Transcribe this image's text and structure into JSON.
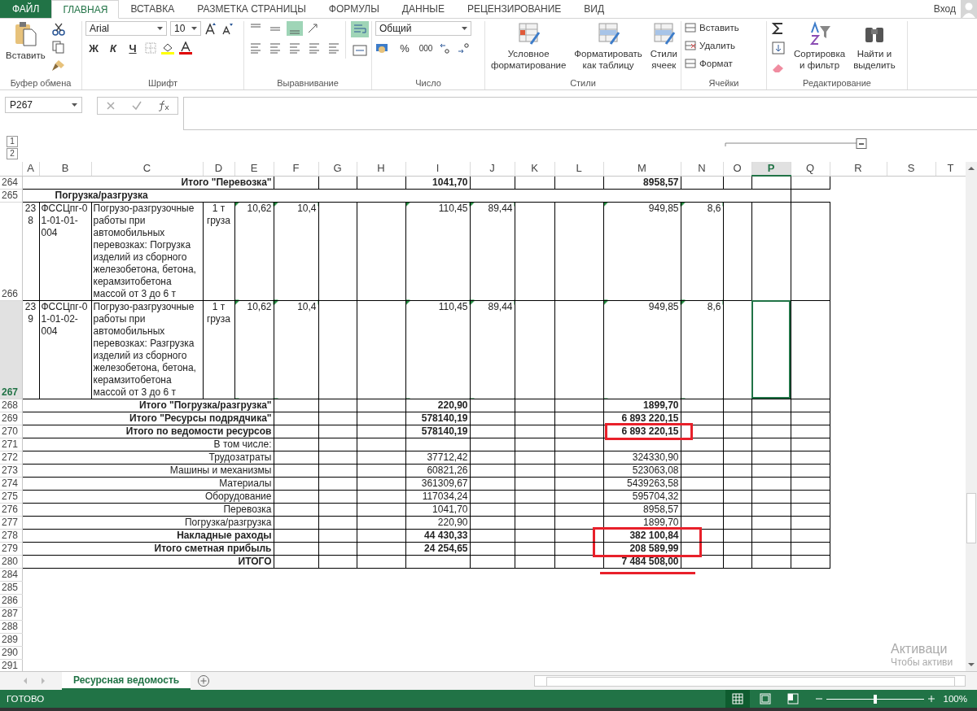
{
  "ribbon_tabs": [
    {
      "label": "ФАЙЛ",
      "kind": "file",
      "selected": false
    },
    {
      "label": "ГЛАВНАЯ",
      "kind": "tab",
      "selected": true
    },
    {
      "label": "ВСТАВКА",
      "kind": "tab",
      "selected": false
    },
    {
      "label": "РАЗМЕТКА СТРАНИЦЫ",
      "kind": "tab",
      "selected": false
    },
    {
      "label": "ФОРМУЛЫ",
      "kind": "tab",
      "selected": false
    },
    {
      "label": "ДАННЫЕ",
      "kind": "tab",
      "selected": false
    },
    {
      "label": "РЕЦЕНЗИРОВАНИЕ",
      "kind": "tab",
      "selected": false
    },
    {
      "label": "ВИД",
      "kind": "tab",
      "selected": false
    }
  ],
  "sign_in": "Вход",
  "ribbon": {
    "clipboard": {
      "paste": "Вставить",
      "label": "Буфер обмена"
    },
    "font": {
      "family": "Arial",
      "size": "10",
      "bold": "Ж",
      "italic": "К",
      "underline": "Ч",
      "label": "Шрифт"
    },
    "alignment": {
      "vertical": [
        {
          "selected": false
        },
        {
          "selected": false
        },
        {
          "selected": true
        }
      ],
      "wrap_text": {
        "on": true
      },
      "label": "Выравнивание"
    },
    "number": {
      "format": "Общий",
      "percent": "%",
      "thousands": "000",
      "label": "Число"
    },
    "styles": {
      "buttons": [
        {
          "lines": [
            "Условное",
            "форматирование"
          ]
        },
        {
          "lines": [
            "Форматировать",
            "как таблицу"
          ]
        },
        {
          "lines": [
            "Стили",
            "ячеек"
          ]
        }
      ],
      "label": "Стили"
    },
    "cells": {
      "buttons": [
        "Вставить",
        "Удалить",
        "Формат"
      ],
      "label": "Ячейки"
    },
    "editing": {
      "buttons": [
        {
          "lines": [
            "Сортировка",
            "и фильтр"
          ]
        },
        {
          "lines": [
            "Найти и",
            "выделить"
          ]
        }
      ],
      "label": "Редактирование"
    }
  },
  "formula_bar": {
    "name_box": "P267"
  },
  "outline_levels": [
    "1",
    "2"
  ],
  "grid": {
    "columns": [
      {
        "label": "A",
        "selected": false
      },
      {
        "label": "B",
        "selected": false
      },
      {
        "label": "C",
        "selected": false
      },
      {
        "label": "D",
        "selected": false
      },
      {
        "label": "E",
        "selected": false
      },
      {
        "label": "F",
        "selected": false
      },
      {
        "label": "G",
        "selected": false
      },
      {
        "label": "H",
        "selected": false
      },
      {
        "label": "I",
        "selected": false
      },
      {
        "label": "J",
        "selected": false
      },
      {
        "label": "K",
        "selected": false
      },
      {
        "label": "L",
        "selected": false
      },
      {
        "label": "M",
        "selected": false
      },
      {
        "label": "N",
        "selected": false
      },
      {
        "label": "O",
        "selected": false
      },
      {
        "label": "P",
        "selected": true
      },
      {
        "label": "Q",
        "selected": false
      },
      {
        "label": "R",
        "selected": false
      },
      {
        "label": "S",
        "selected": false
      },
      {
        "label": "T",
        "selected": false
      }
    ],
    "rows": [
      {
        "number": "264",
        "kind": "total",
        "selected": false,
        "label": "Итого \"Перевозка\"",
        "value_i": "1041,70",
        "value_m": "8958,57"
      },
      {
        "number": "265",
        "kind": "section",
        "selected": false,
        "label": "Погрузка/разгрузка"
      },
      {
        "number": "266",
        "kind": "item",
        "selected": false,
        "num": "238",
        "code": "ФССЦпг-01-01-01-004",
        "description": "Погрузо-разгрузочные работы при автомобильных перевозках: Погрузка изделий из сборного железобетона, бетона, керамзитобетона массой от 3 до 6 т",
        "unit": "1 т груза",
        "value_e": "10,62",
        "value_f": "10,4",
        "value_i": "110,45",
        "value_j": "89,44",
        "value_m": "949,85",
        "value_n": "8,6"
      },
      {
        "number": "267",
        "kind": "item",
        "selected": true,
        "num": "239",
        "code": "ФССЦпг-01-01-02-004",
        "description": "Погрузо-разгрузочные работы при автомобильных перевозках: Разгрузка изделий из сборного железобетона, бетона, керамзитобетона массой от 3 до 6 т",
        "unit": "1 т груза",
        "value_e": "10,62",
        "value_f": "10,4",
        "value_i": "110,45",
        "value_j": "89,44",
        "value_m": "949,85",
        "value_n": "8,6"
      },
      {
        "number": "268",
        "kind": "total",
        "selected": false,
        "label": "Итого \"Погрузка/разгрузка\"",
        "value_i": "220,90",
        "value_m": "1899,70"
      },
      {
        "number": "269",
        "kind": "total",
        "selected": false,
        "label": "Итого \"Ресурсы подрядчика\"",
        "value_i": "578140,19",
        "value_m": "6 893 220,15"
      },
      {
        "number": "270",
        "kind": "total",
        "selected": false,
        "label": "Итого по ведомости ресурсов",
        "value_i": "578140,19",
        "value_m": "6 893 220,15",
        "highlighted": true
      },
      {
        "number": "271",
        "kind": "detail",
        "selected": false,
        "label": "В том числе:"
      },
      {
        "number": "272",
        "kind": "detail",
        "selected": false,
        "label": "Трудозатраты",
        "value_i": "37712,42",
        "value_m": "324330,90"
      },
      {
        "number": "273",
        "kind": "detail",
        "selected": false,
        "label": "Машины и механизмы",
        "value_i": "60821,26",
        "value_m": "523063,08"
      },
      {
        "number": "274",
        "kind": "detail",
        "selected": false,
        "label": "Материалы",
        "value_i": "361309,67",
        "value_m": "5439263,58"
      },
      {
        "number": "275",
        "kind": "detail",
        "selected": false,
        "label": "Оборудование",
        "value_i": "117034,24",
        "value_m": "595704,32"
      },
      {
        "number": "276",
        "kind": "detail",
        "selected": false,
        "label": "Перевозка",
        "value_i": "1041,70",
        "value_m": "8958,57"
      },
      {
        "number": "277",
        "kind": "detail",
        "selected": false,
        "label": "Погрузка/разгрузка",
        "value_i": "220,90",
        "value_m": "1899,70"
      },
      {
        "number": "278",
        "kind": "total",
        "selected": false,
        "label": "Накладные раходы",
        "value_i": "44 430,33",
        "value_m": "382 100,84",
        "highlighted": true
      },
      {
        "number": "279",
        "kind": "total",
        "selected": false,
        "label": "Итого сметная прибыль",
        "value_i": "24 254,65",
        "value_m": "208 589,99",
        "highlighted": true
      },
      {
        "number": "280",
        "kind": "total",
        "selected": false,
        "label": "ИТОГО",
        "value_m": "7 484 508,00",
        "underlined": true
      }
    ],
    "empty_rows": [
      "284",
      "285",
      "286",
      "287",
      "288",
      "289",
      "290",
      "291"
    ]
  },
  "sheet_tabs": [
    {
      "label": "Ресурсная ведомость",
      "selected": true
    }
  ],
  "activation_notice": [
    "Активаци",
    "Чтобы активи"
  ],
  "status_bar": {
    "status": "ГОТОВО",
    "views": [
      {
        "selected": true
      },
      {
        "selected": false
      },
      {
        "selected": false
      }
    ],
    "zoom": {
      "level": 0.5
    },
    "zoom_text": "100%"
  }
}
